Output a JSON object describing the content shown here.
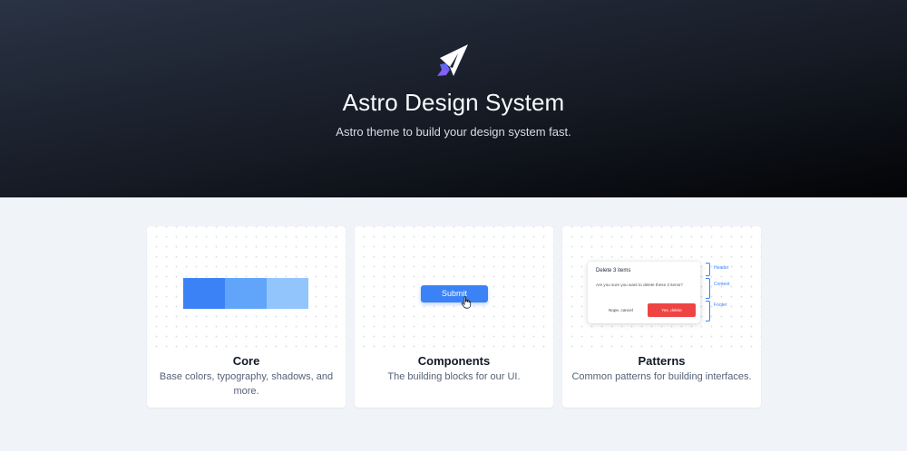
{
  "hero": {
    "title": "Astro Design System",
    "subtitle": "Astro theme to build your design system fast.",
    "logo_icon": "astro-rocket-icon"
  },
  "colors": {
    "accent": "#3b82f6",
    "accent_medium": "#60a5fa",
    "accent_light": "#93c5fd",
    "danger": "#ef4444",
    "page_bg": "#f0f4f8"
  },
  "cards": [
    {
      "title": "Core",
      "description": "Base colors, typography, shadows, and more."
    },
    {
      "title": "Components",
      "description": "The building blocks for our UI.",
      "demo": {
        "button_label": "Submit",
        "cursor_icon": "hand-pointer-icon"
      }
    },
    {
      "title": "Patterns",
      "description": "Common patterns for building interfaces.",
      "demo": {
        "modal_title": "Delete 3 items",
        "modal_body": "Are you sure you want to delete these 3 items?",
        "cancel_label": "Nope, cancel",
        "delete_label": "Yes, delete",
        "annotations": [
          "Header",
          "Content",
          "Footer"
        ]
      }
    }
  ]
}
